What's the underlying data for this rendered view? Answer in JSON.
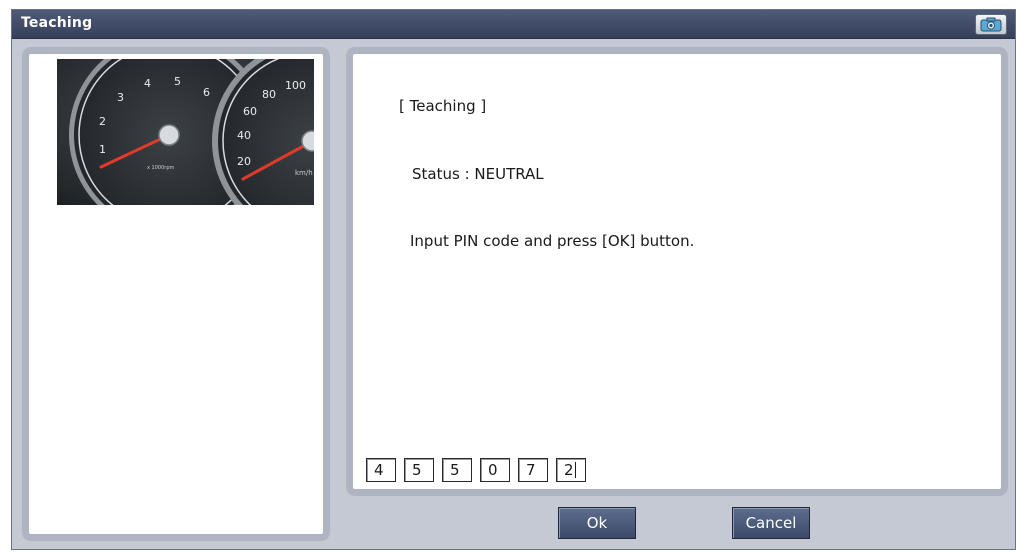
{
  "window": {
    "title": "Teaching"
  },
  "gauge": {
    "tach_labels": [
      "1",
      "2",
      "3",
      "4",
      "5",
      "6"
    ],
    "tach_unit": "x 1000rpm",
    "speed_labels": [
      "20",
      "40",
      "60",
      "80",
      "100"
    ],
    "speed_unit": "km/h"
  },
  "content": {
    "heading": "[ Teaching ]",
    "status": "Status : NEUTRAL",
    "instruction": "Input PIN code and press [OK] button."
  },
  "pin": {
    "digits": [
      "4",
      "5",
      "5",
      "0",
      "7",
      "2"
    ]
  },
  "buttons": {
    "ok_label": "Ok",
    "cancel_label": "Cancel"
  },
  "colors": {
    "titlebar": "#3d4763",
    "panel_border": "#aeb4c1",
    "button": "#4b5a7a",
    "needle": "#e03a2a"
  },
  "icons": {
    "camera": "camera-icon"
  }
}
